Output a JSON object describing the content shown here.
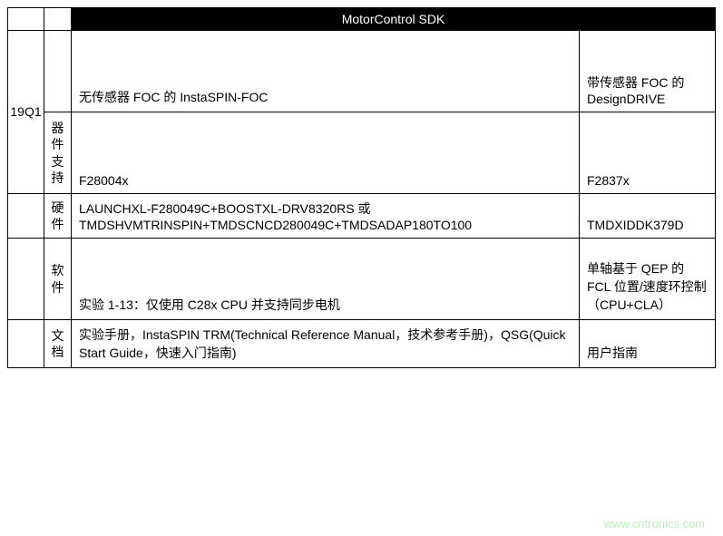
{
  "header": {
    "title": "MotorControl SDK"
  },
  "rowLabel": "19Q1",
  "categories": {
    "device": "器件支持",
    "hardware": "硬件",
    "software": "软件",
    "docs": "文档"
  },
  "rows": {
    "topic": {
      "col1": "无传感器 FOC 的 InstaSPIN-FOC",
      "col2": "带传感器 FOC 的 DesignDRIVE"
    },
    "device": {
      "col1": "F28004x",
      "col2": "F2837x"
    },
    "hardware": {
      "col1": "LAUNCHXL-F280049C+BOOSTXL-DRV8320RS 或 TMDSHVMTRINSPIN+TMDSCNCD280049C+TMDSADAP180TO100",
      "col2": "TMDXIDDK379D"
    },
    "software": {
      "col1": "实验 1-13：仅使用 C28x CPU 并支持同步电机",
      "col2": "单轴基于 QEP 的 FCL 位置/速度环控制（CPU+CLA）"
    },
    "docs": {
      "col1": "实验手册，InstaSPIN TRM(Technical Reference Manual，技术参考手册)，QSG(Quick Start Guide，快速入门指南)",
      "col2": "用户指南"
    }
  },
  "watermark": "www.cntronics.com"
}
